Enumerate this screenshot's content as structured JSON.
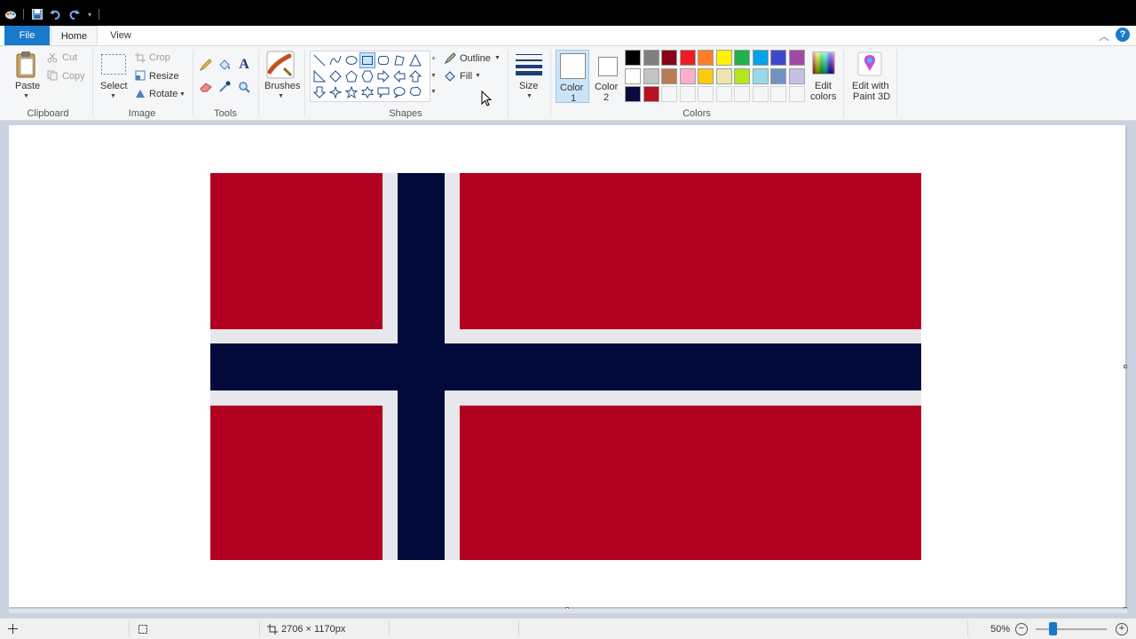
{
  "tabs": {
    "file": "File",
    "home": "Home",
    "view": "View"
  },
  "clipboard": {
    "paste": "Paste",
    "cut": "Cut",
    "copy": "Copy",
    "group_label": "Clipboard"
  },
  "image": {
    "select": "Select",
    "crop": "Crop",
    "resize": "Resize",
    "rotate": "Rotate",
    "group_label": "Image"
  },
  "tools": {
    "group_label": "Tools",
    "text_tool_glyph": "A"
  },
  "brushes": {
    "label": "Brushes"
  },
  "shapes": {
    "outline": "Outline",
    "fill": "Fill",
    "group_label": "Shapes"
  },
  "size": {
    "label": "Size"
  },
  "colors": {
    "color1_line1": "Color",
    "color1_line2": "1",
    "color2_line1": "Color",
    "color2_line2": "2",
    "edit_colors_line1": "Edit",
    "edit_colors_line2": "colors",
    "paint3d_line1": "Edit with",
    "paint3d_line2": "Paint 3D",
    "group_label": "Colors",
    "palette_row1": [
      "#000000",
      "#7f7f7f",
      "#880015",
      "#ed1c24",
      "#ff7f27",
      "#fff200",
      "#22b14c",
      "#00a2e8",
      "#3f48cc",
      "#a349a4"
    ],
    "palette_row2": [
      "#ffffff",
      "#c3c3c3",
      "#b97a57",
      "#ffaec9",
      "#ffc90e",
      "#efe4b0",
      "#b5e61d",
      "#99d9ea",
      "#7092be",
      "#c8bfe7"
    ],
    "palette_row3": [
      "#0a0a3c",
      "#b5141e"
    ]
  },
  "help_glyph": "?",
  "status": {
    "dimensions": "2706 × 1170px",
    "zoom": "50%",
    "zoom_out": "−",
    "zoom_in": "+"
  },
  "flag_colors": {
    "red": "#b20020",
    "white": "#e8e8ec",
    "blue": "#020a3c"
  }
}
